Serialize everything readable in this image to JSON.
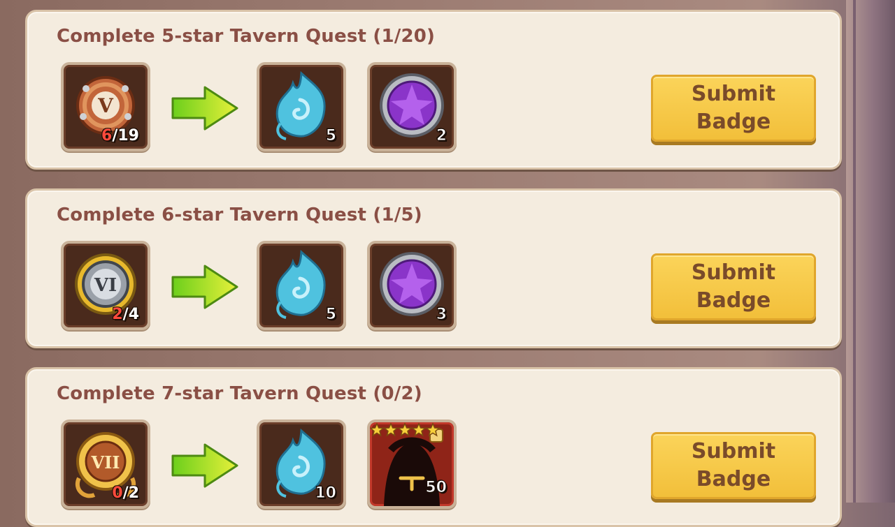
{
  "quests": [
    {
      "title": "Complete 5-star Tavern Quest (1/20)",
      "badge": {
        "numeral": "V",
        "have": "6",
        "need": "/19",
        "icon": "bronze-badge-v-icon"
      },
      "rewards": [
        {
          "icon": "blue-spirit-flame-icon",
          "count": "5"
        },
        {
          "icon": "purple-gem-icon",
          "count": "2"
        }
      ],
      "button": "Submit\nBadge"
    },
    {
      "title": "Complete 6-star Tavern Quest (1/5)",
      "badge": {
        "numeral": "VI",
        "have": "2",
        "need": "/4",
        "icon": "silver-badge-vi-icon"
      },
      "rewards": [
        {
          "icon": "blue-spirit-flame-icon",
          "count": "5"
        },
        {
          "icon": "purple-gem-icon",
          "count": "3"
        }
      ],
      "button": "Submit\nBadge"
    },
    {
      "title": "Complete 7-star Tavern Quest (0/2)",
      "badge": {
        "numeral": "VII",
        "have": "0",
        "need": "/2",
        "icon": "gold-badge-vii-icon"
      },
      "rewards": [
        {
          "icon": "blue-spirit-flame-icon",
          "count": "10"
        },
        {
          "icon": "hero-shard-silhouette-icon",
          "count": "50",
          "stars": 5
        }
      ],
      "button": "Submit\nBadge"
    }
  ],
  "colors": {
    "card_bg": "#f4ecdf",
    "title": "#8a4f45",
    "button": "#f6c94a",
    "button_text": "#7a4b2a",
    "have_count": "#ff4a3c"
  }
}
